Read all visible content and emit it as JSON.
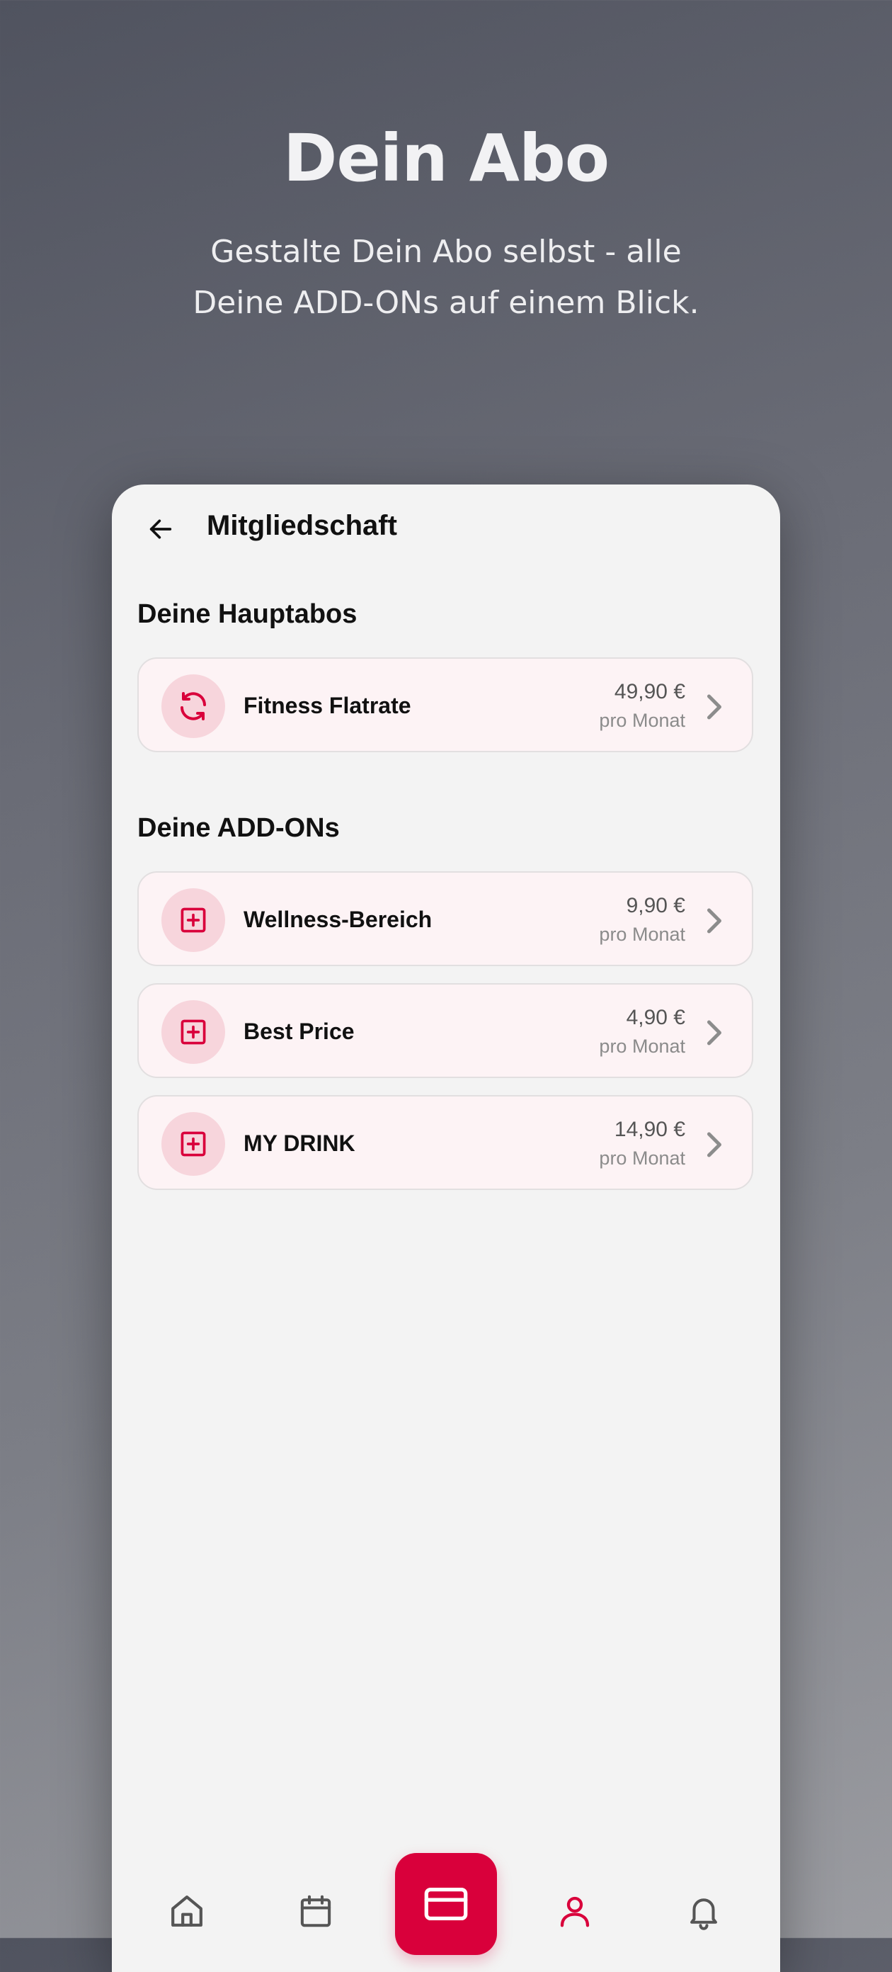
{
  "hero": {
    "title": "Dein Abo",
    "subtitle_line1": "Gestalte Dein Abo selbst - alle",
    "subtitle_line2": "Deine ADD-ONs auf einem Blick."
  },
  "appbar": {
    "title": "Mitgliedschaft",
    "back_icon": "arrow-left-icon"
  },
  "main_subscriptions": {
    "title": "Deine Hauptabos",
    "items": [
      {
        "name": "Fitness Flatrate",
        "price": "49,90 €",
        "period": "pro Monat",
        "icon": "refresh-icon"
      }
    ]
  },
  "addons": {
    "title": "Deine ADD-ONs",
    "items": [
      {
        "name": "Wellness-Bereich",
        "price": "9,90 €",
        "period": "pro Monat",
        "icon": "plus-square-icon"
      },
      {
        "name": "Best Price",
        "price": "4,90 €",
        "period": "pro Monat",
        "icon": "plus-square-icon"
      },
      {
        "name": "MY DRINK",
        "price": "14,90 €",
        "period": "pro Monat",
        "icon": "plus-square-icon"
      }
    ]
  },
  "navbar": {
    "items": [
      "home-icon",
      "calendar-icon",
      "card-icon",
      "profile-icon",
      "bell-icon"
    ],
    "active": "profile-icon"
  },
  "colors": {
    "accent": "#d9003b",
    "card_bg": "#fdf3f5",
    "icon_bg": "#f7d5dc",
    "screen_bg": "#f3f3f3"
  }
}
